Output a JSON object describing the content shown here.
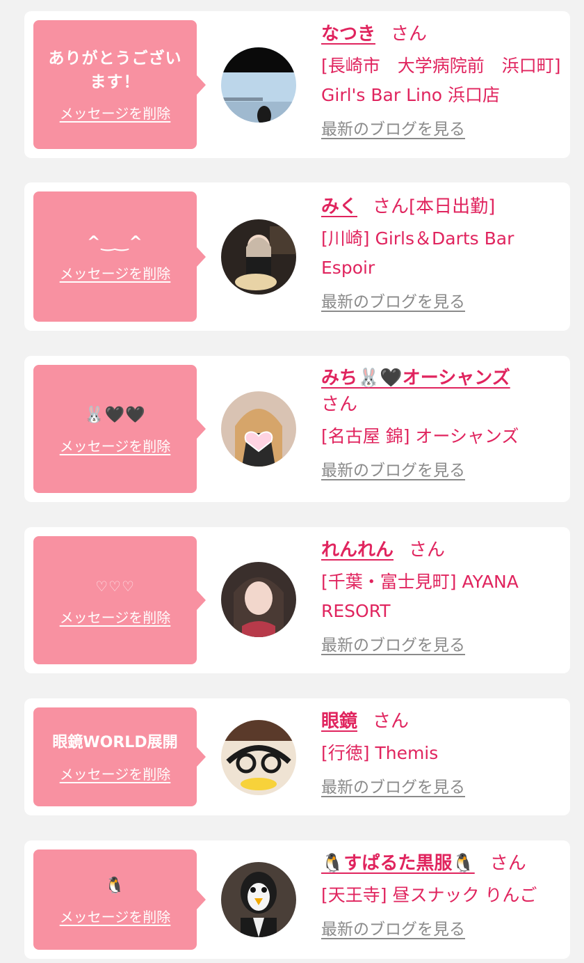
{
  "colors": {
    "accent": "#e0245e",
    "bubble": "#f891a1",
    "background": "#f2f2f2"
  },
  "delete_label": "メッセージを削除",
  "blog_label": "最新のブログを見る",
  "san_label": "さん",
  "cards": [
    {
      "message": "ありがとうございます！",
      "name": "なつき",
      "tag": "",
      "shop": "[長崎市　大学病院前　浜口町] Girl's Bar Lino 浜口店",
      "avatar": "sea-photo"
    },
    {
      "message": "^‿‿^",
      "name": "みく",
      "tag": "[本日出勤]",
      "shop": "[川崎] Girls＆Darts Bar Espoir",
      "avatar": "girl-cake-photo"
    },
    {
      "message": "🐰🖤🖤",
      "name": "みち🐰🖤オーシャンズ",
      "tag": "",
      "shop": "[名古屋 錦] オーシャンズ",
      "avatar": "heart-sticker-photo"
    },
    {
      "message": "♡♡♡",
      "name": "れんれん",
      "tag": "",
      "shop": "[千葉・富士見町] AYANA RESORT",
      "avatar": "girl-portrait-photo"
    },
    {
      "message": "眼鏡WORLD展開",
      "name": "眼鏡",
      "tag": "",
      "shop": "[行徳] Themis",
      "avatar": "glasses-photo"
    },
    {
      "message": "🐧",
      "name": "🐧すぱるた黒服🐧",
      "tag": "",
      "shop": "[天王寺] 昼スナック りんご",
      "avatar": "penguin-mask-photo"
    }
  ]
}
